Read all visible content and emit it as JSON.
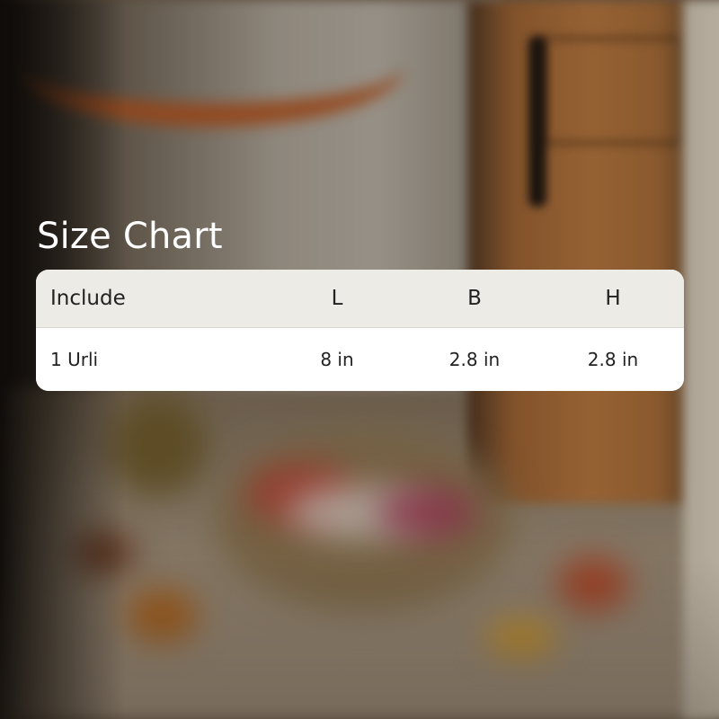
{
  "page": {
    "title": "Size Chart"
  },
  "size_chart": {
    "headers": [
      "Include",
      "L",
      "B",
      "H"
    ],
    "rows": [
      [
        "1 Urli",
        "8 in",
        "2.8 in",
        "2.8 in"
      ]
    ]
  },
  "colors": {
    "title_text": "#ffffff",
    "header_background": "#ecebe5",
    "row_background": "#ffffff",
    "cell_text": "#222222"
  }
}
